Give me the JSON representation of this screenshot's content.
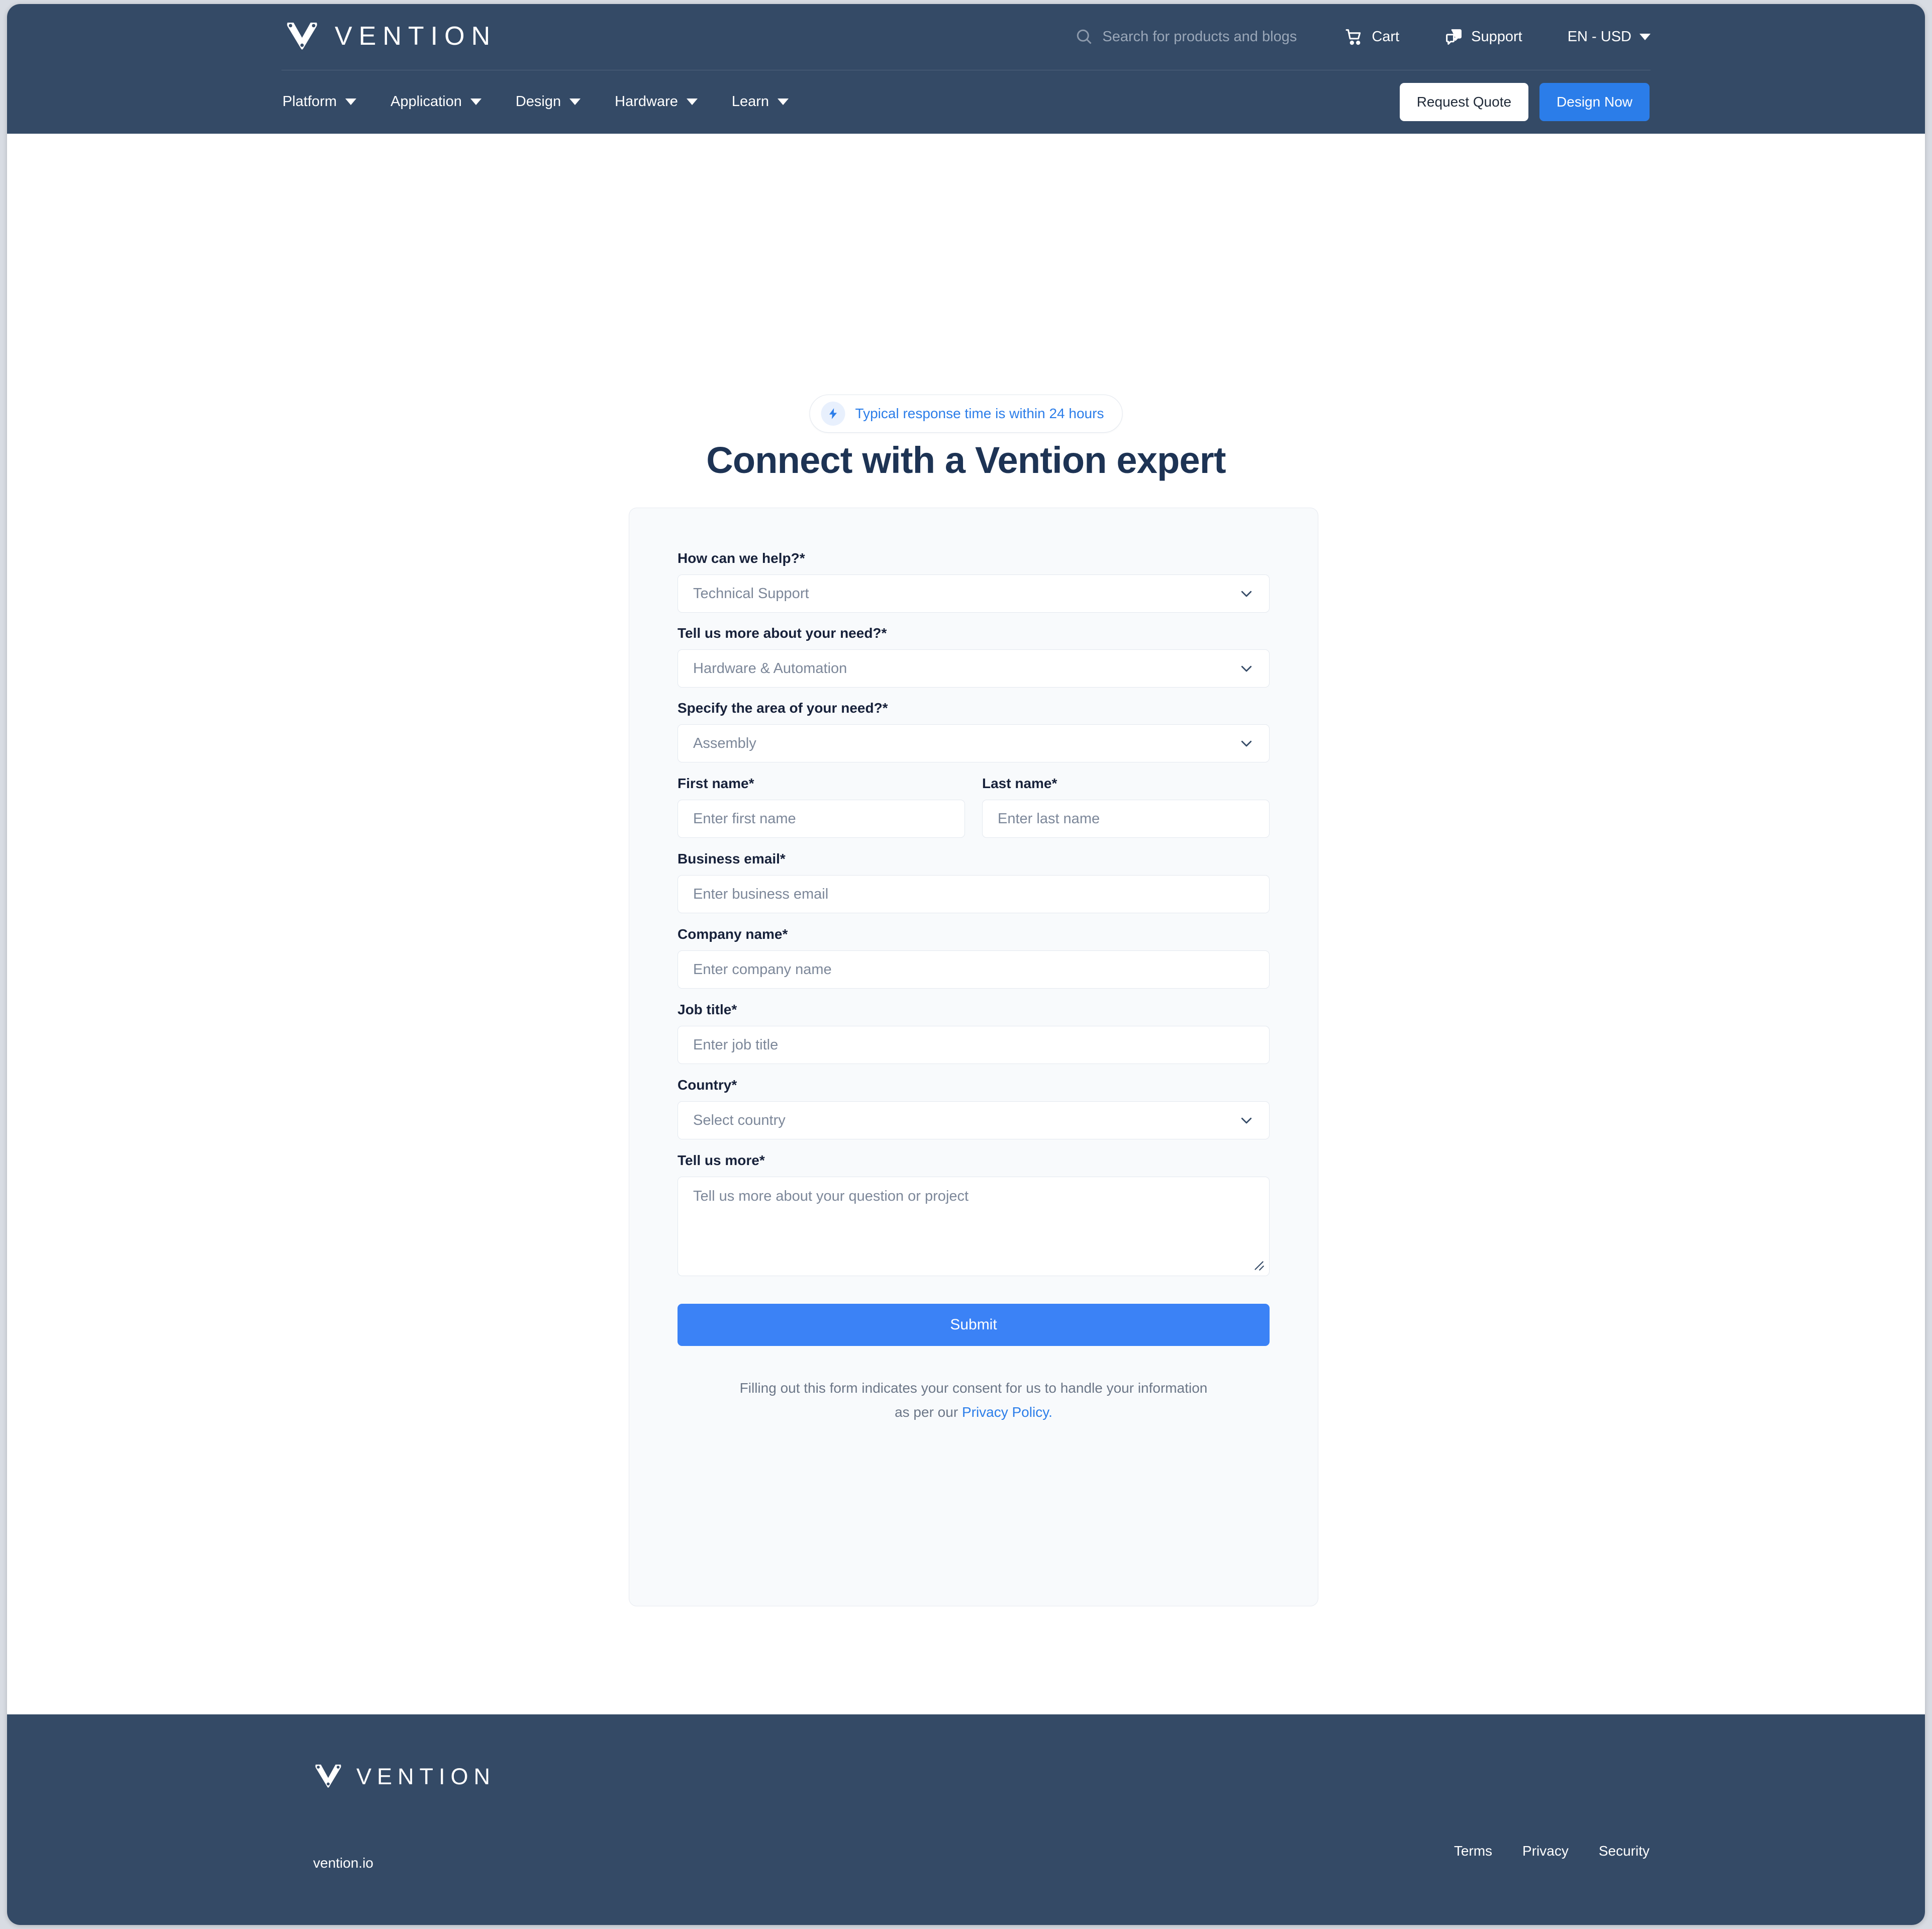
{
  "colors": {
    "header_bg": "#344a66",
    "accent_blue": "#2b7de9",
    "submit_blue": "#3b82f6",
    "title_navy": "#1d3354",
    "card_bg": "#f8fafc",
    "placeholder": "#7c8799"
  },
  "header": {
    "logo_word": "VENTION",
    "logo_icon": "vention-v-logo-icon",
    "search": {
      "icon": "search-icon",
      "placeholder": "Search for products and blogs"
    },
    "cart": {
      "icon": "cart-icon",
      "label": "Cart"
    },
    "support": {
      "icon": "support-chat-icon",
      "label": "Support"
    },
    "locale": {
      "label": "EN - USD",
      "icon": "chevron-down-icon"
    },
    "nav": [
      {
        "label": "Platform",
        "icon": "chevron-down-icon"
      },
      {
        "label": "Application",
        "icon": "chevron-down-icon"
      },
      {
        "label": "Design",
        "icon": "chevron-down-icon"
      },
      {
        "label": "Hardware",
        "icon": "chevron-down-icon"
      },
      {
        "label": "Learn",
        "icon": "chevron-down-icon"
      }
    ],
    "cta_quote": "Request Quote",
    "cta_design": "Design Now"
  },
  "main": {
    "badge": {
      "icon": "lightning-bolt-icon",
      "text": "Typical response time is within 24 hours"
    },
    "title": "Connect with a Vention expert",
    "form": {
      "how_can_we_help": {
        "label": "How can we help?*",
        "value": "Technical Support",
        "icon": "chevron-down-icon"
      },
      "tell_us_more_need": {
        "label": "Tell us more about your need?*",
        "value": "Hardware & Automation",
        "icon": "chevron-down-icon"
      },
      "specify_area": {
        "label": "Specify the area of your need?*",
        "value": "Assembly",
        "icon": "chevron-down-icon"
      },
      "first_name": {
        "label": "First name*",
        "placeholder": "Enter first name",
        "value": ""
      },
      "last_name": {
        "label": "Last name*",
        "placeholder": "Enter last name",
        "value": ""
      },
      "business_email": {
        "label": "Business email*",
        "placeholder": "Enter business email",
        "value": ""
      },
      "company_name": {
        "label": "Company name*",
        "placeholder": "Enter company name",
        "value": ""
      },
      "job_title": {
        "label": "Job title*",
        "placeholder": "Enter job title",
        "value": ""
      },
      "country": {
        "label": "Country*",
        "value": "Select country",
        "icon": "chevron-down-icon"
      },
      "tell_us_more": {
        "label": "Tell us more*",
        "placeholder": "Tell us more about your question or project",
        "value": ""
      },
      "submit_label": "Submit",
      "consent_line1": "Filling out this form indicates your consent for us to handle your information",
      "consent_line2_prefix": "as per our ",
      "consent_link": "Privacy Policy."
    }
  },
  "footer": {
    "logo_word": "VENTION",
    "logo_icon": "vention-v-logo-icon",
    "url": "vention.io",
    "links": [
      "Terms",
      "Privacy",
      "Security"
    ]
  }
}
